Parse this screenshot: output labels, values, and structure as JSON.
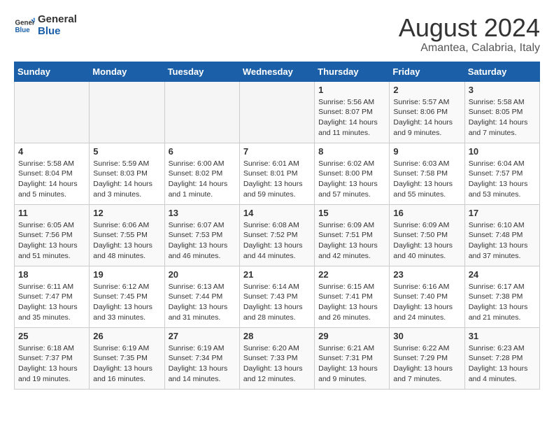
{
  "header": {
    "logo_line1": "General",
    "logo_line2": "Blue",
    "month_title": "August 2024",
    "subtitle": "Amantea, Calabria, Italy"
  },
  "days_of_week": [
    "Sunday",
    "Monday",
    "Tuesday",
    "Wednesday",
    "Thursday",
    "Friday",
    "Saturday"
  ],
  "weeks": [
    [
      {
        "day": "",
        "text": ""
      },
      {
        "day": "",
        "text": ""
      },
      {
        "day": "",
        "text": ""
      },
      {
        "day": "",
        "text": ""
      },
      {
        "day": "1",
        "text": "Sunrise: 5:56 AM\nSunset: 8:07 PM\nDaylight: 14 hours\nand 11 minutes."
      },
      {
        "day": "2",
        "text": "Sunrise: 5:57 AM\nSunset: 8:06 PM\nDaylight: 14 hours\nand 9 minutes."
      },
      {
        "day": "3",
        "text": "Sunrise: 5:58 AM\nSunset: 8:05 PM\nDaylight: 14 hours\nand 7 minutes."
      }
    ],
    [
      {
        "day": "4",
        "text": "Sunrise: 5:58 AM\nSunset: 8:04 PM\nDaylight: 14 hours\nand 5 minutes."
      },
      {
        "day": "5",
        "text": "Sunrise: 5:59 AM\nSunset: 8:03 PM\nDaylight: 14 hours\nand 3 minutes."
      },
      {
        "day": "6",
        "text": "Sunrise: 6:00 AM\nSunset: 8:02 PM\nDaylight: 14 hours\nand 1 minute."
      },
      {
        "day": "7",
        "text": "Sunrise: 6:01 AM\nSunset: 8:01 PM\nDaylight: 13 hours\nand 59 minutes."
      },
      {
        "day": "8",
        "text": "Sunrise: 6:02 AM\nSunset: 8:00 PM\nDaylight: 13 hours\nand 57 minutes."
      },
      {
        "day": "9",
        "text": "Sunrise: 6:03 AM\nSunset: 7:58 PM\nDaylight: 13 hours\nand 55 minutes."
      },
      {
        "day": "10",
        "text": "Sunrise: 6:04 AM\nSunset: 7:57 PM\nDaylight: 13 hours\nand 53 minutes."
      }
    ],
    [
      {
        "day": "11",
        "text": "Sunrise: 6:05 AM\nSunset: 7:56 PM\nDaylight: 13 hours\nand 51 minutes."
      },
      {
        "day": "12",
        "text": "Sunrise: 6:06 AM\nSunset: 7:55 PM\nDaylight: 13 hours\nand 48 minutes."
      },
      {
        "day": "13",
        "text": "Sunrise: 6:07 AM\nSunset: 7:53 PM\nDaylight: 13 hours\nand 46 minutes."
      },
      {
        "day": "14",
        "text": "Sunrise: 6:08 AM\nSunset: 7:52 PM\nDaylight: 13 hours\nand 44 minutes."
      },
      {
        "day": "15",
        "text": "Sunrise: 6:09 AM\nSunset: 7:51 PM\nDaylight: 13 hours\nand 42 minutes."
      },
      {
        "day": "16",
        "text": "Sunrise: 6:09 AM\nSunset: 7:50 PM\nDaylight: 13 hours\nand 40 minutes."
      },
      {
        "day": "17",
        "text": "Sunrise: 6:10 AM\nSunset: 7:48 PM\nDaylight: 13 hours\nand 37 minutes."
      }
    ],
    [
      {
        "day": "18",
        "text": "Sunrise: 6:11 AM\nSunset: 7:47 PM\nDaylight: 13 hours\nand 35 minutes."
      },
      {
        "day": "19",
        "text": "Sunrise: 6:12 AM\nSunset: 7:45 PM\nDaylight: 13 hours\nand 33 minutes."
      },
      {
        "day": "20",
        "text": "Sunrise: 6:13 AM\nSunset: 7:44 PM\nDaylight: 13 hours\nand 31 minutes."
      },
      {
        "day": "21",
        "text": "Sunrise: 6:14 AM\nSunset: 7:43 PM\nDaylight: 13 hours\nand 28 minutes."
      },
      {
        "day": "22",
        "text": "Sunrise: 6:15 AM\nSunset: 7:41 PM\nDaylight: 13 hours\nand 26 minutes."
      },
      {
        "day": "23",
        "text": "Sunrise: 6:16 AM\nSunset: 7:40 PM\nDaylight: 13 hours\nand 24 minutes."
      },
      {
        "day": "24",
        "text": "Sunrise: 6:17 AM\nSunset: 7:38 PM\nDaylight: 13 hours\nand 21 minutes."
      }
    ],
    [
      {
        "day": "25",
        "text": "Sunrise: 6:18 AM\nSunset: 7:37 PM\nDaylight: 13 hours\nand 19 minutes."
      },
      {
        "day": "26",
        "text": "Sunrise: 6:19 AM\nSunset: 7:35 PM\nDaylight: 13 hours\nand 16 minutes."
      },
      {
        "day": "27",
        "text": "Sunrise: 6:19 AM\nSunset: 7:34 PM\nDaylight: 13 hours\nand 14 minutes."
      },
      {
        "day": "28",
        "text": "Sunrise: 6:20 AM\nSunset: 7:33 PM\nDaylight: 13 hours\nand 12 minutes."
      },
      {
        "day": "29",
        "text": "Sunrise: 6:21 AM\nSunset: 7:31 PM\nDaylight: 13 hours\nand 9 minutes."
      },
      {
        "day": "30",
        "text": "Sunrise: 6:22 AM\nSunset: 7:29 PM\nDaylight: 13 hours\nand 7 minutes."
      },
      {
        "day": "31",
        "text": "Sunrise: 6:23 AM\nSunset: 7:28 PM\nDaylight: 13 hours\nand 4 minutes."
      }
    ]
  ]
}
